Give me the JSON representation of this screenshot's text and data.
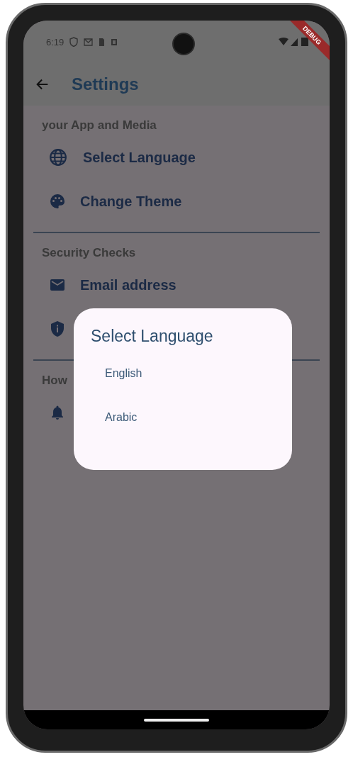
{
  "status_bar": {
    "time": "6:19"
  },
  "debug_banner": "DEBUG",
  "app_bar": {
    "title": "Settings"
  },
  "sections": [
    {
      "header": "your App and Media",
      "items": [
        {
          "kind": "labeled",
          "label": "Select Language"
        },
        {
          "kind": "labeled",
          "label": "Change Theme"
        }
      ]
    },
    {
      "header": "Security Checks",
      "items": [
        {
          "kind": "labeled",
          "label": "Email address"
        },
        {
          "kind": "covered"
        }
      ]
    },
    {
      "header": "How",
      "items": [
        {
          "kind": "covered"
        }
      ]
    }
  ],
  "dialog": {
    "title": "Select Language",
    "options": [
      {
        "label": "English"
      },
      {
        "label": "Arabic"
      }
    ]
  }
}
